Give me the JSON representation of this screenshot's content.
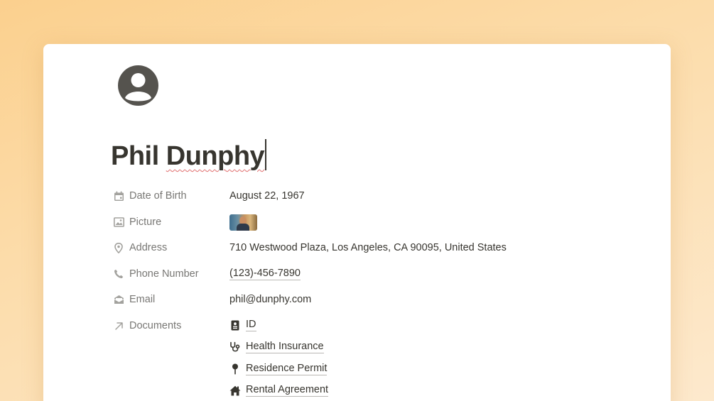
{
  "page": {
    "title": "Phil Dunphy",
    "icon": "user-avatar-icon"
  },
  "properties": [
    {
      "label": "Date of Birth",
      "icon": "calendar-icon",
      "value": "August 22, 1967"
    },
    {
      "label": "Picture",
      "icon": "image-icon",
      "value": ""
    },
    {
      "label": "Address",
      "icon": "location-pin-icon",
      "value": "710 Westwood Plaza, Los Angeles, CA 90095, United States"
    },
    {
      "label": "Phone Number",
      "icon": "phone-icon",
      "value": "(123)-456-7890"
    },
    {
      "label": "Email",
      "icon": "mail-icon",
      "value": "phil@dunphy.com"
    },
    {
      "label": "Documents",
      "icon": "relation-arrow-icon",
      "value": ""
    }
  ],
  "documents": [
    {
      "label": "ID",
      "icon": "id-card-icon"
    },
    {
      "label": "Health Insurance",
      "icon": "stethoscope-icon"
    },
    {
      "label": "Residence Permit",
      "icon": "pushpin-icon"
    },
    {
      "label": "Rental Agreement",
      "icon": "house-icon"
    }
  ],
  "colors": {
    "text": "#37352f",
    "muted": "#787774",
    "background_gradient": [
      "#fbd08e",
      "#fde9cd"
    ]
  }
}
